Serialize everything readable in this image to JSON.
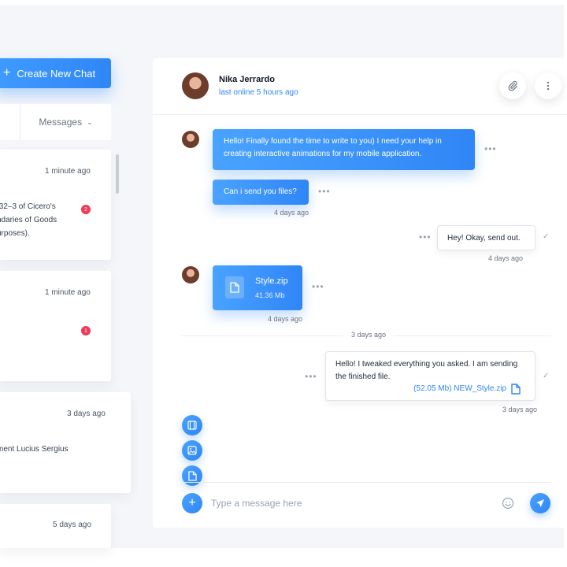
{
  "sidebar": {
    "create_button": "Create New Chat",
    "filter_select": "Messages",
    "chats": [
      {
        "time": "1 minute ago",
        "snippet_lines": [
          ".32–3 of Cicero's",
          "ndaries of Goods",
          "urposes)."
        ],
        "unread": "2"
      },
      {
        "time": "1 minute ago",
        "snippet_lines": [],
        "unread": "1"
      },
      {
        "time": "3 days ago",
        "snippet_lines": [
          "ment Lucius Sergius"
        ],
        "unread": ""
      },
      {
        "time": "5 days ago",
        "snippet_lines": [],
        "unread": ""
      }
    ]
  },
  "chat": {
    "contact_name": "Nika Jerrardo",
    "contact_status": "last online 5 hours ago",
    "messages": {
      "m1_line1": "Hello! Finally found the time to write to you) I need your help in",
      "m1_line2": "creating interactive animations for my mobile application.",
      "m2": "Can i send you files?",
      "m2_time": "4 days ago",
      "m3": "Hey! Okay, send out.",
      "m3_time": "4 days ago",
      "file_name": "Style.zip",
      "file_size": "41.36 Mb",
      "file_time": "4 days ago",
      "day_divider": "3 days ago",
      "m5_line1": "Hello! I tweaked everything you asked. I am sending",
      "m5_line2": "the finished file.",
      "m5_attachment": "(52.05 Mb) NEW_Style.zip",
      "m5_time": "3 days ago"
    },
    "composer_placeholder": "Type a message here"
  },
  "colors": {
    "accent": "#2f86f6",
    "badge": "#ef3a59",
    "background": "#f4f6fa"
  },
  "icons": {
    "header": [
      "paperclip-icon",
      "more-vertical-icon"
    ],
    "side_tools": [
      "film-icon",
      "image-icon",
      "file-icon"
    ],
    "composer": [
      "plus-icon",
      "emoji-icon",
      "send-icon"
    ]
  }
}
